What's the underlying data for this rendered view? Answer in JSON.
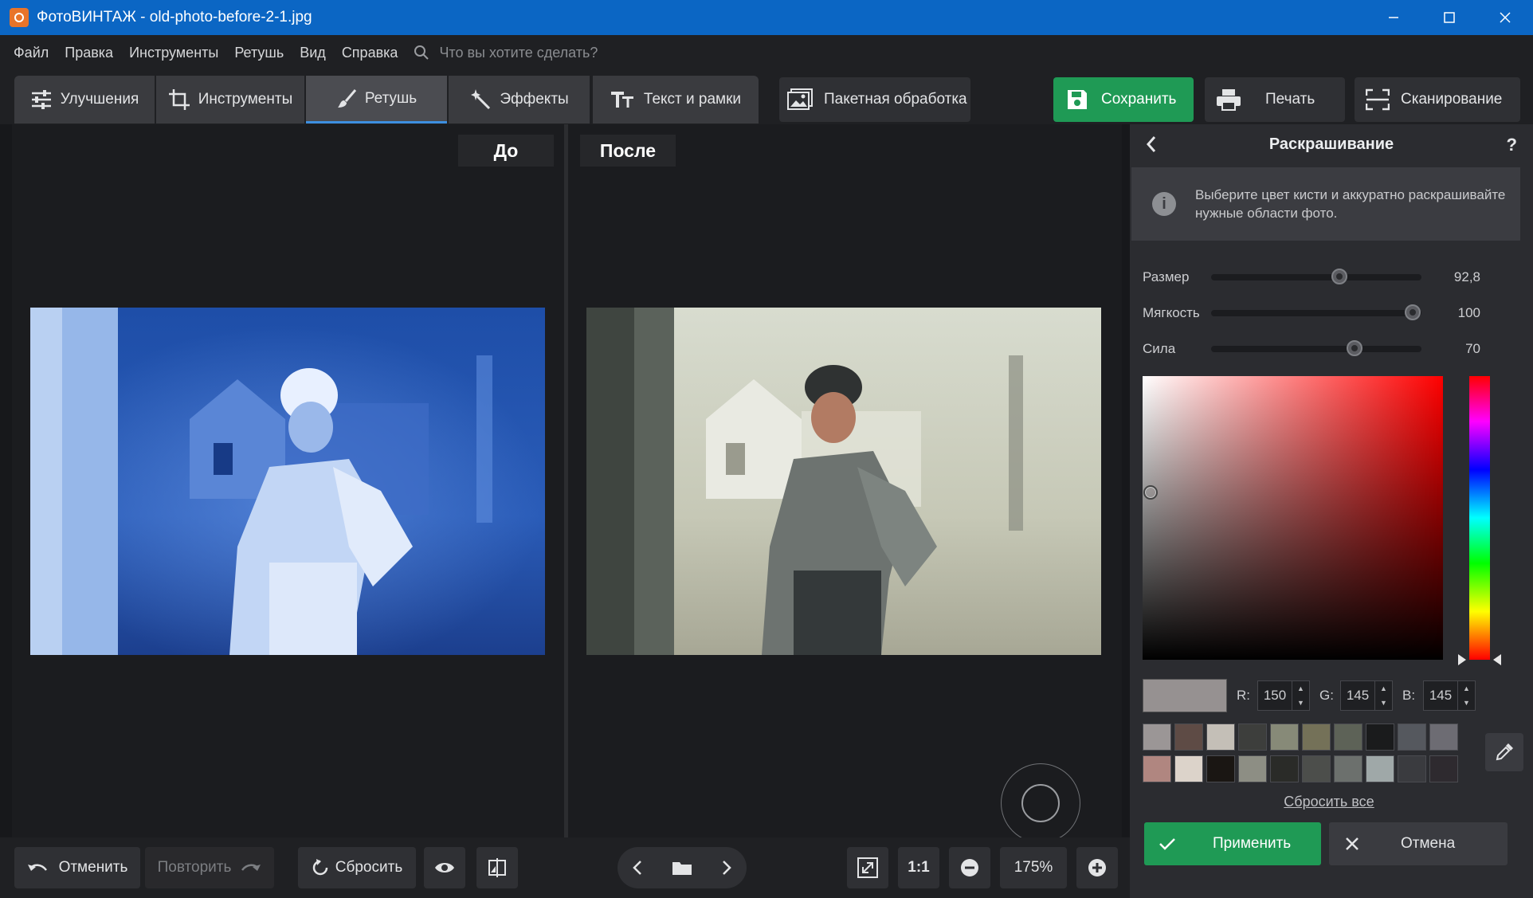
{
  "window": {
    "title": "ФотоВИНТАЖ - old-photo-before-2-1.jpg",
    "accent": "#0b66c4"
  },
  "menu": {
    "items": [
      "Файл",
      "Правка",
      "Инструменты",
      "Ретушь",
      "Вид",
      "Справка"
    ],
    "search_placeholder": "Что вы хотите сделать?"
  },
  "tabs": [
    {
      "label": "Улучшения",
      "icon": "sliders-icon"
    },
    {
      "label": "Инструменты",
      "icon": "crop-icon"
    },
    {
      "label": "Ретушь",
      "icon": "brush-icon",
      "active": true
    },
    {
      "label": "Эффекты",
      "icon": "magic-wand-icon"
    },
    {
      "label": "Текст и рамки",
      "icon": "text-icon"
    }
  ],
  "toolbar": {
    "batch_label": "Пакетная обработка",
    "save_label": "Сохранить",
    "print_label": "Печать",
    "scan_label": "Сканирование",
    "save_color": "#1f9a55"
  },
  "canvas": {
    "before_label": "До",
    "after_label": "После"
  },
  "bottom": {
    "undo_label": "Отменить",
    "redo_label": "Повторить",
    "reset_label": "Сбросить",
    "ratio_label": "1:1",
    "zoom": "175%"
  },
  "panel": {
    "title": "Раскрашивание",
    "help": "?",
    "info": "Выберите цвет кисти и аккуратно раскрашивайте нужные области фото.",
    "sliders": [
      {
        "label": "Размер",
        "value": "92,8",
        "fraction": 0.61
      },
      {
        "label": "Мягкость",
        "value": "100",
        "fraction": 0.96
      },
      {
        "label": "Сила",
        "value": "70",
        "fraction": 0.68
      }
    ],
    "color": {
      "r": "150",
      "g": "145",
      "b": "145",
      "hex": "#969191"
    },
    "rgb_labels": {
      "r": "R:",
      "g": "G:",
      "b": "B:"
    },
    "palette": [
      "#9b9696",
      "#5e4b45",
      "#c4bfb7",
      "#3d3e3c",
      "#878a78",
      "#747158",
      "#5d6257",
      "#1a1b1c",
      "#55585e",
      "#6d6c73",
      "#b08680",
      "#dcd3ca",
      "#1a1613",
      "#8d8e84",
      "#2a2b28",
      "#4c4e4b",
      "#6c706d",
      "#9fa8a8",
      "#3a3b3f",
      "#2e2a2f"
    ],
    "reset_all": "Сбросить все",
    "apply_label": "Применить",
    "cancel_label": "Отмена"
  }
}
